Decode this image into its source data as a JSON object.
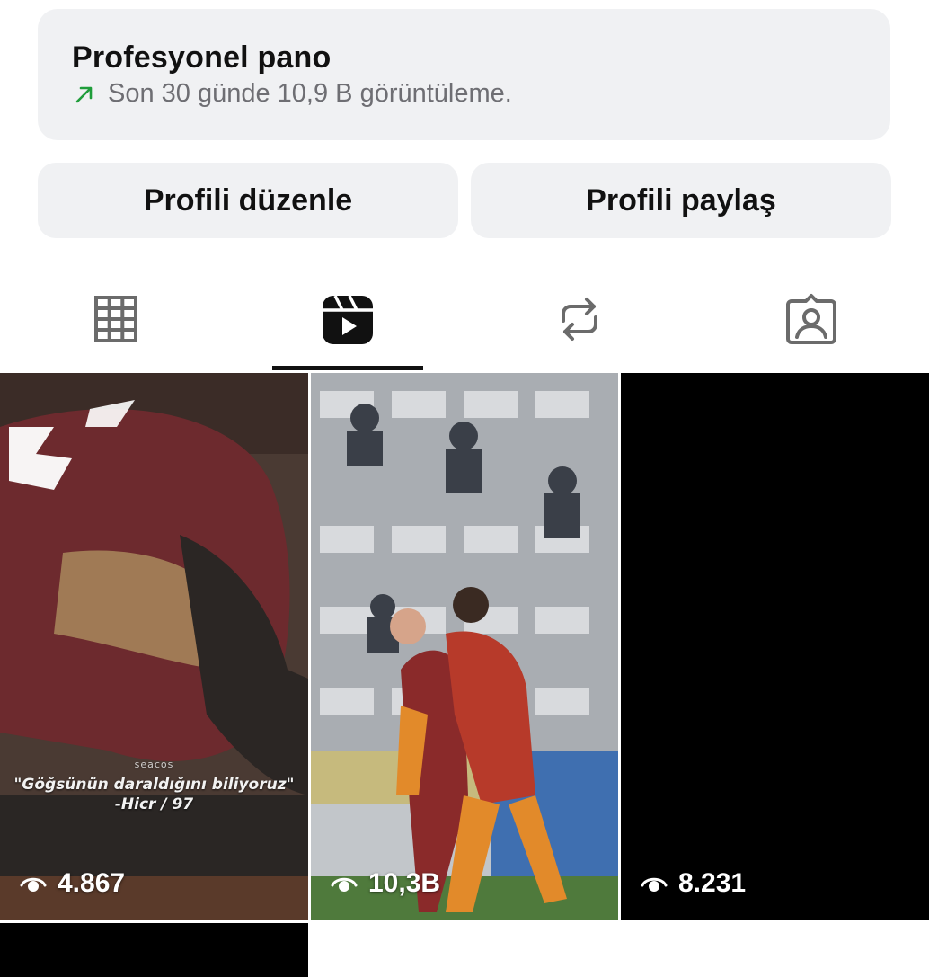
{
  "dashboard": {
    "title": "Profesyonel pano",
    "subtitle": "Son 30 günde 10,9 B görüntüleme.",
    "trend_color": "#1f9d3a",
    "trend_icon": "arrow-up-right-icon"
  },
  "buttons": {
    "edit_label": "Profili düzenle",
    "share_label": "Profili paylaş"
  },
  "tabs": [
    {
      "name": "posts",
      "icon": "grid-icon",
      "active": false
    },
    {
      "name": "reels",
      "icon": "reels-icon",
      "active": true
    },
    {
      "name": "reposts",
      "icon": "repost-icon",
      "active": false
    },
    {
      "name": "tagged",
      "icon": "tagged-person-icon",
      "active": false
    }
  ],
  "reels": [
    {
      "views": "4.867",
      "caption_small": "seacos",
      "caption_line1": "\"Göğsünün daraldığını biliyoruz\"",
      "caption_line2": "-Hicr / 97"
    },
    {
      "views": "10,3B"
    },
    {
      "views": "8.231"
    }
  ],
  "colors": {
    "card_bg": "#f0f1f3",
    "text": "#111111",
    "muted": "#6e6e73",
    "icon_inactive": "#6b6b6b"
  }
}
